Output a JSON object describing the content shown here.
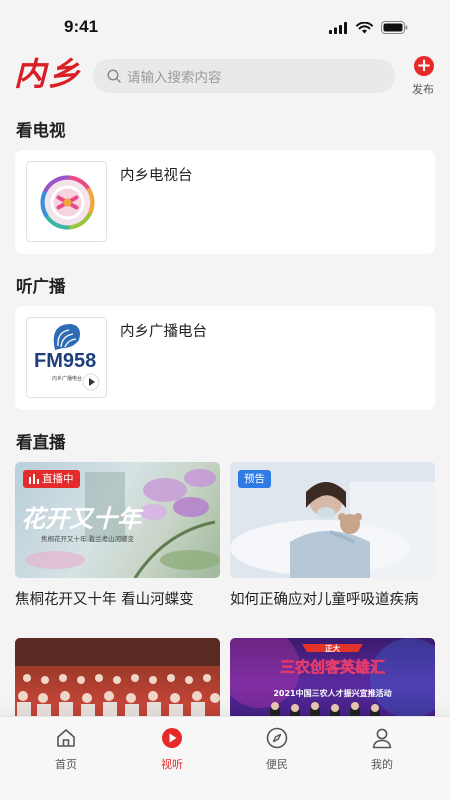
{
  "status": {
    "time": "9:41"
  },
  "header": {
    "logo_text": "内乡",
    "search_placeholder": "请输入搜索内容",
    "publish_label": "发布"
  },
  "sections": {
    "tv": {
      "title": "看电视",
      "item_name": "内乡电视台"
    },
    "radio": {
      "title": "听广播",
      "item_name": "内乡广播电台",
      "logo_text": "FM958",
      "logo_subtext": "内乡广播电台"
    },
    "live": {
      "title": "看直播",
      "items": [
        {
          "badge": "直播中",
          "title": "焦桐花开又十年 看山河蝶变",
          "overlay_title": "花开又十年",
          "overlay_sub": "焦桐花开又十年 看兰考山河蝶变"
        },
        {
          "badge": "预告",
          "title": "如何正确应对儿童呼吸道疾病"
        },
        {
          "title": ""
        },
        {
          "overlay_title": "三农创客英雄汇",
          "overlay_brand": "正大",
          "overlay_sub": "2021中国三农人才振兴宣推活动"
        }
      ]
    }
  },
  "tabbar": {
    "items": [
      {
        "label": "首页",
        "icon": "home-icon"
      },
      {
        "label": "视听",
        "icon": "play-icon"
      },
      {
        "label": "便民",
        "icon": "compass-icon"
      },
      {
        "label": "我的",
        "icon": "user-icon"
      }
    ],
    "active_color": "#e62a2a"
  },
  "colors": {
    "brand_red": "#d91e26",
    "live_badge": "#e52c2c",
    "preview_badge": "#2f7be6"
  }
}
